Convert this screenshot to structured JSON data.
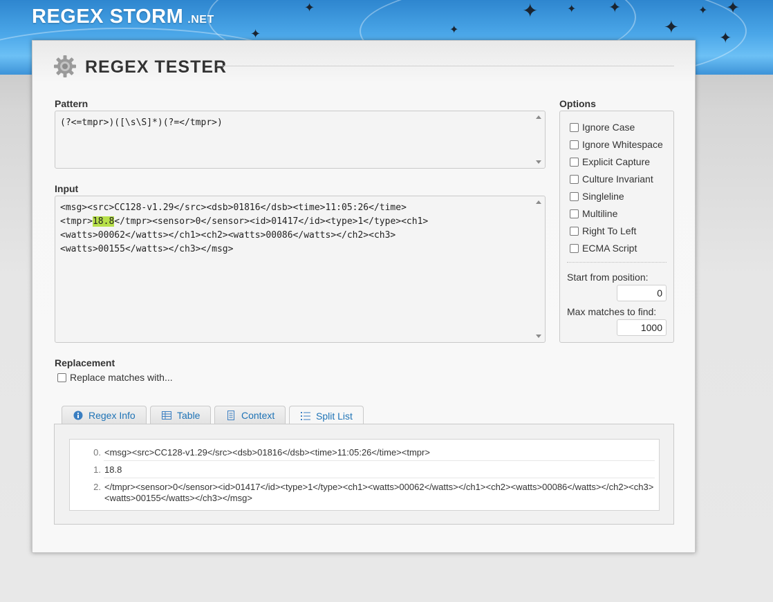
{
  "brand": {
    "name": "REGEX STORM",
    "tld": ".NET"
  },
  "page_title": "REGEX TESTER",
  "pattern": {
    "label": "Pattern",
    "value": "(?<=tmpr>)([\\s\\S]*)(?=</tmpr>)"
  },
  "input": {
    "label": "Input",
    "before": "<msg><src>CC128-v1.29</src><dsb>01816</dsb><time>11:05:26</time>\n<tmpr>",
    "match": "18.8",
    "after": "</tmpr><sensor>0</sensor><id>01417</id><type>1</type><ch1>\n<watts>00062</watts></ch1><ch2><watts>00086</watts></ch2><ch3>\n<watts>00155</watts></ch3></msg>"
  },
  "options": {
    "label": "Options",
    "items": [
      {
        "label": "Ignore Case",
        "checked": false
      },
      {
        "label": "Ignore Whitespace",
        "checked": false
      },
      {
        "label": "Explicit Capture",
        "checked": false
      },
      {
        "label": "Culture Invariant",
        "checked": false
      },
      {
        "label": "Singleline",
        "checked": false
      },
      {
        "label": "Multiline",
        "checked": false
      },
      {
        "label": "Right To Left",
        "checked": false
      },
      {
        "label": "ECMA Script",
        "checked": false
      }
    ],
    "start_label": "Start from position:",
    "start_value": "0",
    "max_label": "Max matches to find:",
    "max_value": "1000"
  },
  "replacement": {
    "label": "Replacement",
    "checkbox_label": "Replace matches with...",
    "checked": false
  },
  "tabs": [
    {
      "label": "Regex Info",
      "icon": "info-icon",
      "active": false
    },
    {
      "label": "Table",
      "icon": "table-icon",
      "active": false
    },
    {
      "label": "Context",
      "icon": "document-icon",
      "active": false
    },
    {
      "label": "Split List",
      "icon": "list-icon",
      "active": true
    }
  ],
  "split_list": [
    {
      "index": "0.",
      "text": "<msg><src>CC128-v1.29</src><dsb>01816</dsb><time>11:05:26</time><tmpr>"
    },
    {
      "index": "1.",
      "text": "18.8"
    },
    {
      "index": "2.",
      "text": "</tmpr><sensor>0</sensor><id>01417</id><type>1</type><ch1><watts>00062</watts></ch1><ch2><watts>00086</watts></ch2><ch3><watts>00155</watts></ch3></msg>"
    }
  ],
  "colors": {
    "accent": "#1e73b6",
    "highlight": "#b7e04a",
    "banner": "#3d93d8"
  }
}
